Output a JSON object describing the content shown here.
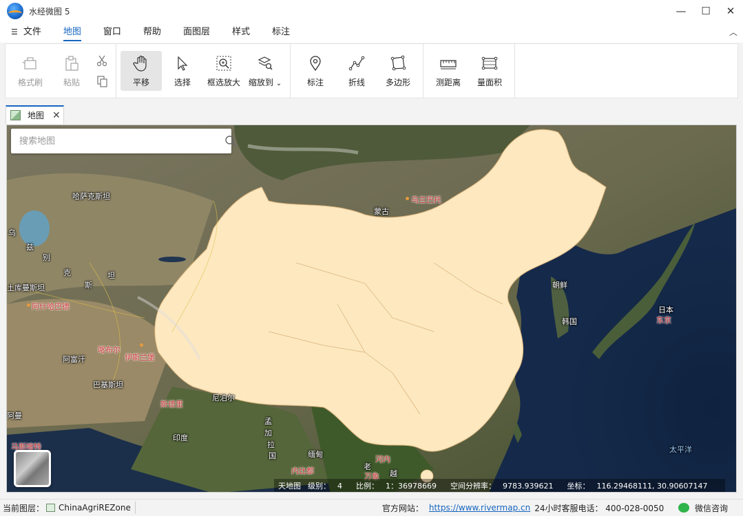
{
  "app": {
    "title": "水经微图 5"
  },
  "window_controls": {
    "minimize": "—",
    "maximize": "☐",
    "close": "✕"
  },
  "menu": {
    "hamburger": "☰",
    "items": [
      {
        "label": "文件"
      },
      {
        "label": "地图"
      },
      {
        "label": "窗口"
      },
      {
        "label": "帮助"
      },
      {
        "label": "面图层"
      },
      {
        "label": "样式"
      },
      {
        "label": "标注"
      }
    ],
    "active_index": 1,
    "collapse": "︿"
  },
  "ribbon": {
    "format_brush": "格式刷",
    "paste": "粘贴",
    "pan": "平移",
    "select": "选择",
    "box_zoom": "框选放大",
    "zoom_to": "缩放到",
    "zoom_to_caret": "⌄",
    "mark": "标注",
    "polyline": "折线",
    "polygon": "多边形",
    "measure_distance": "测距离",
    "measure_area": "量面积"
  },
  "doc_tab": {
    "label": "地图",
    "close": "✕"
  },
  "search": {
    "placeholder": "搜索地图"
  },
  "map_labels": {
    "kazakhstan": "哈萨克斯坦",
    "mongolia": "蒙古",
    "ulaanbaatar": "乌兰巴托",
    "uz1": "乌",
    "uz2": "兹",
    "uz3": "别",
    "kg1": "克",
    "kg2": "斯",
    "kg3": "坦",
    "turkmenistan": "土库曼斯坦",
    "ashgabat": "阿什哈巴德",
    "kabul": "喀布尔",
    "islamabad": "伊斯兰堡",
    "afghanistan": "阿富汗",
    "pakistan": "巴基斯坦",
    "new_delhi": "新德里",
    "nepal": "尼泊尔",
    "india": "印度",
    "bd1": "孟",
    "bd2": "加",
    "bd3": "拉",
    "bd4": "国",
    "myanmar": "缅甸",
    "naypyidaw": "内比都",
    "laos": "老",
    "vientiane": "万象",
    "viet": "越",
    "hanoi": "河内",
    "north_korea": "朝鲜",
    "south_korea": "韩国",
    "japan": "日本",
    "tokyo": "东京",
    "pacific": "太平洋",
    "oman": "阿曼",
    "muscat": "马斯喀特"
  },
  "map_status": {
    "basemap": "天地图",
    "level_label": "级别：",
    "level": "4",
    "scale_label": "比例：",
    "scale": "1：36978669",
    "resolution_label": "空间分辨率：",
    "resolution": "9783.939621",
    "coord_label": "坐标：",
    "coord": "116.29468111,  30.90607147"
  },
  "statusbar": {
    "current_layer_label": "当前图层：",
    "current_layer": "ChinaAgriREZone",
    "website_label": "官方网站：",
    "website": "https://www.rivermap.cn",
    "hotline": "24小时客服电话：  400-028-0050",
    "wechat": "微信咨询"
  }
}
